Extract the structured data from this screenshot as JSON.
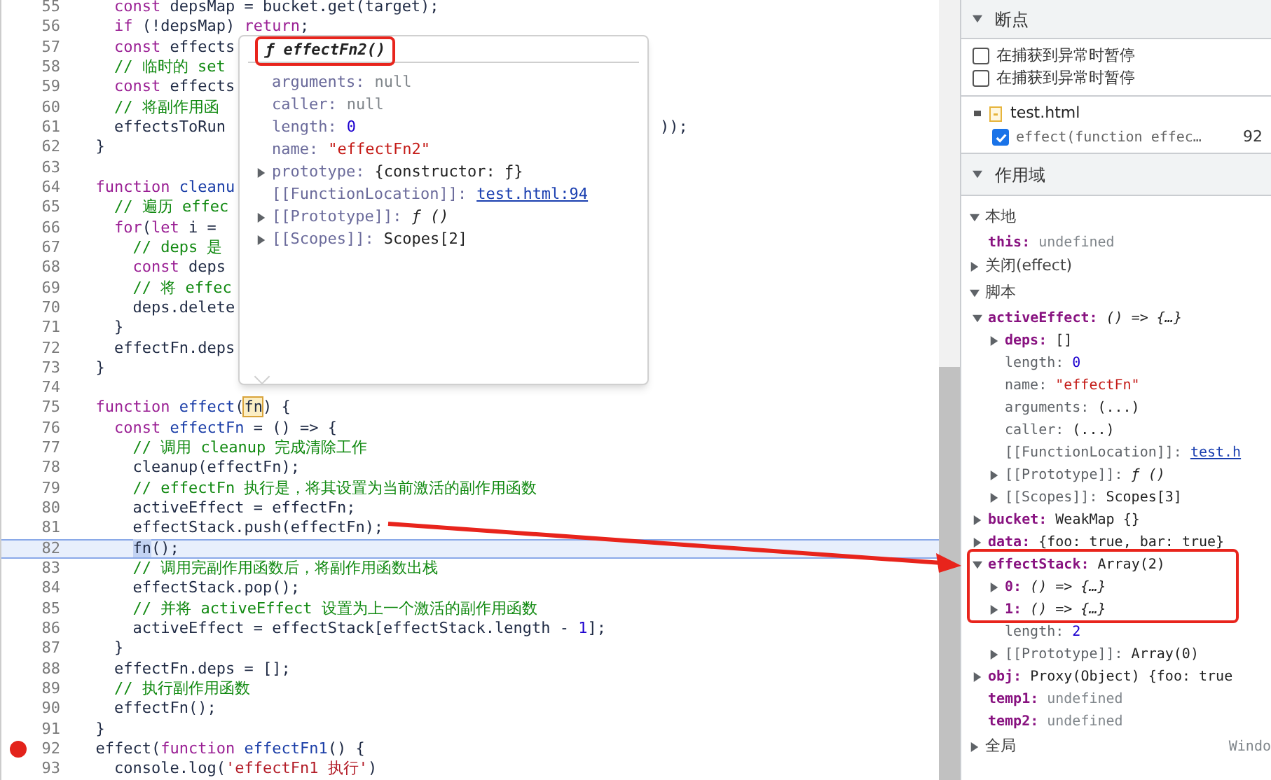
{
  "code": {
    "lines": [
      {
        "number": "55",
        "breakpoint": false,
        "current": false,
        "segments": [
          {
            "kind": "keyword",
            "text": "    const"
          },
          {
            "kind": "plain",
            "text": " depsMap = bucket.get(target);"
          }
        ]
      },
      {
        "number": "56",
        "breakpoint": false,
        "current": false,
        "segments": [
          {
            "kind": "keyword",
            "text": "    if"
          },
          {
            "kind": "plain",
            "text": " (!depsMap) "
          },
          {
            "kind": "keyword",
            "text": "return"
          },
          {
            "kind": "plain",
            "text": ";"
          }
        ]
      },
      {
        "number": "57",
        "breakpoint": false,
        "current": false,
        "segments": [
          {
            "kind": "keyword",
            "text": "    const"
          },
          {
            "kind": "plain",
            "text": " effects"
          }
        ]
      },
      {
        "number": "58",
        "breakpoint": false,
        "current": false,
        "segments": [
          {
            "kind": "comment",
            "text": "    // 临时的 set"
          }
        ]
      },
      {
        "number": "59",
        "breakpoint": false,
        "current": false,
        "segments": [
          {
            "kind": "keyword",
            "text": "    const"
          },
          {
            "kind": "plain",
            "text": " effects"
          }
        ]
      },
      {
        "number": "60",
        "breakpoint": false,
        "current": false,
        "segments": [
          {
            "kind": "comment",
            "text": "    // 将副作用函"
          }
        ]
      },
      {
        "number": "61",
        "breakpoint": false,
        "current": false,
        "segments": [
          {
            "kind": "plain",
            "text": "    effectsToRun"
          }
        ],
        "tail": "));"
      },
      {
        "number": "62",
        "breakpoint": false,
        "current": false,
        "segments": [
          {
            "kind": "plain",
            "text": "  }"
          }
        ]
      },
      {
        "number": "63",
        "breakpoint": false,
        "current": false
      },
      {
        "number": "64",
        "breakpoint": false,
        "current": false,
        "segments": [
          {
            "kind": "keyword",
            "text": "  function"
          },
          {
            "kind": "def",
            "text": " cleanu"
          }
        ]
      },
      {
        "number": "65",
        "breakpoint": false,
        "current": false,
        "segments": [
          {
            "kind": "comment",
            "text": "    // 遍历 effec"
          }
        ]
      },
      {
        "number": "66",
        "breakpoint": false,
        "current": false,
        "segments": [
          {
            "kind": "keyword",
            "text": "    for"
          },
          {
            "kind": "plain",
            "text": "("
          },
          {
            "kind": "keyword",
            "text": "let"
          },
          {
            "kind": "plain",
            "text": " i ="
          }
        ]
      },
      {
        "number": "67",
        "breakpoint": false,
        "current": false,
        "segments": [
          {
            "kind": "comment",
            "text": "      // deps 是"
          }
        ]
      },
      {
        "number": "68",
        "breakpoint": false,
        "current": false,
        "segments": [
          {
            "kind": "keyword",
            "text": "      const"
          },
          {
            "kind": "plain",
            "text": " deps"
          }
        ]
      },
      {
        "number": "69",
        "breakpoint": false,
        "current": false,
        "segments": [
          {
            "kind": "comment",
            "text": "      // 将 effec"
          }
        ]
      },
      {
        "number": "70",
        "breakpoint": false,
        "current": false,
        "segments": [
          {
            "kind": "plain",
            "text": "      deps.delete"
          }
        ]
      },
      {
        "number": "71",
        "breakpoint": false,
        "current": false,
        "segments": [
          {
            "kind": "plain",
            "text": "    }"
          }
        ]
      },
      {
        "number": "72",
        "breakpoint": false,
        "current": false,
        "segments": [
          {
            "kind": "plain",
            "text": "    effectFn.deps"
          }
        ]
      },
      {
        "number": "73",
        "breakpoint": false,
        "current": false,
        "segments": [
          {
            "kind": "plain",
            "text": "  }"
          }
        ]
      },
      {
        "number": "74",
        "breakpoint": false,
        "current": false
      },
      {
        "number": "75",
        "breakpoint": false,
        "current": false,
        "segments": [
          {
            "kind": "keyword",
            "text": "  function"
          },
          {
            "kind": "def",
            "text": " effect"
          },
          {
            "kind": "plain",
            "text": "("
          },
          {
            "kind": "match",
            "text": "fn"
          },
          {
            "kind": "plain",
            "text": ") {"
          }
        ]
      },
      {
        "number": "76",
        "breakpoint": false,
        "current": false,
        "segments": [
          {
            "kind": "keyword",
            "text": "    const"
          },
          {
            "kind": "def",
            "text": " effectFn"
          },
          {
            "kind": "plain",
            "text": " = () => {"
          }
        ]
      },
      {
        "number": "77",
        "breakpoint": false,
        "current": false,
        "segments": [
          {
            "kind": "comment",
            "text": "      // 调用 cleanup 完成清除工作"
          }
        ]
      },
      {
        "number": "78",
        "breakpoint": false,
        "current": false,
        "segments": [
          {
            "kind": "plain",
            "text": "      cleanup(effectFn);"
          }
        ]
      },
      {
        "number": "79",
        "breakpoint": false,
        "current": false,
        "segments": [
          {
            "kind": "comment",
            "text": "      // effectFn 执行是，将其设置为当前激活的副作用函数"
          }
        ]
      },
      {
        "number": "80",
        "breakpoint": false,
        "current": false,
        "segments": [
          {
            "kind": "plain",
            "text": "      activeEffect = effectFn;"
          }
        ]
      },
      {
        "number": "81",
        "breakpoint": false,
        "current": false,
        "segments": [
          {
            "kind": "plain",
            "text": "      effectStack.push(effectFn);"
          }
        ]
      },
      {
        "number": "82",
        "breakpoint": false,
        "current": true,
        "segments": [
          {
            "kind": "selection",
            "text": "      fn"
          },
          {
            "kind": "plain",
            "text": "();"
          }
        ]
      },
      {
        "number": "83",
        "breakpoint": false,
        "current": false,
        "segments": [
          {
            "kind": "comment",
            "text": "      // 调用完副作用函数后，将副作用函数出栈"
          }
        ]
      },
      {
        "number": "84",
        "breakpoint": false,
        "current": false,
        "segments": [
          {
            "kind": "plain",
            "text": "      effectStack.pop();"
          }
        ]
      },
      {
        "number": "85",
        "breakpoint": false,
        "current": false,
        "segments": [
          {
            "kind": "comment",
            "text": "      // 并将 activeEffect 设置为上一个激活的副作用函数"
          }
        ]
      },
      {
        "number": "86",
        "breakpoint": false,
        "current": false,
        "segments": [
          {
            "kind": "plain",
            "text": "      activeEffect = effectStack[effectStack.length - "
          },
          {
            "kind": "number",
            "text": "1"
          },
          {
            "kind": "plain",
            "text": "];"
          }
        ]
      },
      {
        "number": "87",
        "breakpoint": false,
        "current": false,
        "segments": [
          {
            "kind": "plain",
            "text": "    }"
          }
        ]
      },
      {
        "number": "88",
        "breakpoint": false,
        "current": false,
        "segments": [
          {
            "kind": "plain",
            "text": "    effectFn.deps = [];"
          }
        ]
      },
      {
        "number": "89",
        "breakpoint": false,
        "current": false,
        "segments": [
          {
            "kind": "comment",
            "text": "    // 执行副作用函数"
          }
        ]
      },
      {
        "number": "90",
        "breakpoint": false,
        "current": false,
        "segments": [
          {
            "kind": "plain",
            "text": "    effectFn();"
          }
        ]
      },
      {
        "number": "91",
        "breakpoint": false,
        "current": false,
        "segments": [
          {
            "kind": "plain",
            "text": "  }"
          }
        ]
      },
      {
        "number": "92",
        "breakpoint": true,
        "current": false,
        "segments": [
          {
            "kind": "plain",
            "text": "  effect("
          },
          {
            "kind": "keyword",
            "text": "function"
          },
          {
            "kind": "def",
            "text": " effectFn1"
          },
          {
            "kind": "plain",
            "text": "() {"
          }
        ]
      },
      {
        "number": "93",
        "breakpoint": false,
        "current": false,
        "segments": [
          {
            "kind": "plain",
            "text": "    console.log("
          },
          {
            "kind": "string",
            "text": "'effectFn1 执行'"
          },
          {
            "kind": "plain",
            "text": ")"
          }
        ]
      }
    ]
  },
  "popup": {
    "title": "ƒ effectFn2()",
    "rows": [
      {
        "key": "arguments:",
        "value": "null",
        "kind": "null"
      },
      {
        "key": "caller:",
        "value": "null",
        "kind": "null"
      },
      {
        "key": "length:",
        "value": "0",
        "kind": "number"
      },
      {
        "key": "name:",
        "value": "\"effectFn2\"",
        "kind": "string"
      },
      {
        "key": "prototype:",
        "value": "{constructor: ƒ}",
        "kind": "plain",
        "expanded": false
      },
      {
        "key": "[[FunctionLocation]]:",
        "value": "test.html:94",
        "kind": "link"
      },
      {
        "key": "[[Prototype]]:",
        "value": "ƒ ()",
        "kind": "function",
        "expanded": false
      },
      {
        "key": "[[Scopes]]:",
        "value": "Scopes[2]",
        "kind": "plain",
        "expanded": false
      }
    ]
  },
  "breakpoints": {
    "title": "断点",
    "expanded": true,
    "options": [
      {
        "label": "在捕获到异常时暂停",
        "checked": false
      },
      {
        "label": "在捕获到异常时暂停",
        "checked": false
      }
    ],
    "file": "test.html",
    "items": [
      {
        "label": "effect(function effec…",
        "line": "92",
        "checked": true
      }
    ]
  },
  "scope": {
    "title": "作用域",
    "expanded": true,
    "sections": [
      {
        "label": "本地",
        "expanded": true,
        "children": [
          {
            "key": "this:",
            "value": "undefined",
            "kind": "undefined",
            "internal": false
          }
        ]
      },
      {
        "label": "关闭(effect)",
        "expanded": false
      },
      {
        "label": "脚本",
        "expanded": true,
        "children": [
          {
            "key": "activeEffect:",
            "value": "() => {…}",
            "kind": "function",
            "internal": false,
            "expanded": true,
            "children": [
              {
                "key": "deps:",
                "value": "[]",
                "kind": "plain",
                "internal": false,
                "expanded": false
              },
              {
                "key": "length:",
                "value": "0",
                "kind": "number",
                "internal": true
              },
              {
                "key": "name:",
                "value": "\"effectFn\"",
                "kind": "string",
                "internal": true
              },
              {
                "key": "arguments:",
                "value": "(...)",
                "kind": "plain",
                "internal": true
              },
              {
                "key": "caller:",
                "value": "(...)",
                "kind": "plain",
                "internal": true
              },
              {
                "key": "[[FunctionLocation]]:",
                "value": "test.h",
                "kind": "link",
                "internal": true
              },
              {
                "key": "[[Prototype]]:",
                "value": "ƒ ()",
                "kind": "function",
                "internal": true,
                "expanded": false
              },
              {
                "key": "[[Scopes]]:",
                "value": "Scopes[3]",
                "kind": "plain",
                "internal": true,
                "expanded": false
              }
            ]
          },
          {
            "key": "bucket:",
            "value": "WeakMap {}",
            "kind": "plain",
            "internal": false,
            "expanded": false
          },
          {
            "key": "data:",
            "value": "{foo: true, bar: true}",
            "kind": "plain",
            "internal": false,
            "expanded": false
          },
          {
            "key": "effectStack:",
            "value": "Array(2)",
            "kind": "plain",
            "internal": false,
            "expanded": true,
            "children": [
              {
                "key": "0:",
                "value": "() => {…}",
                "kind": "function",
                "internal": false,
                "expanded": false
              },
              {
                "key": "1:",
                "value": "() => {…}",
                "kind": "function",
                "internal": false,
                "expanded": false
              },
              {
                "key": "length:",
                "value": "2",
                "kind": "number",
                "internal": true
              },
              {
                "key": "[[Prototype]]:",
                "value": "Array(0)",
                "kind": "plain",
                "internal": true,
                "expanded": false
              }
            ]
          },
          {
            "key": "obj:",
            "value": "Proxy(Object) {foo: true",
            "kind": "plain",
            "internal": false,
            "expanded": false
          },
          {
            "key": "temp1:",
            "value": "undefined",
            "kind": "undefined",
            "internal": false
          },
          {
            "key": "temp2:",
            "value": "undefined",
            "kind": "undefined",
            "internal": false
          }
        ]
      },
      {
        "label": "全局",
        "expanded": false,
        "value": "Windo"
      }
    ]
  }
}
